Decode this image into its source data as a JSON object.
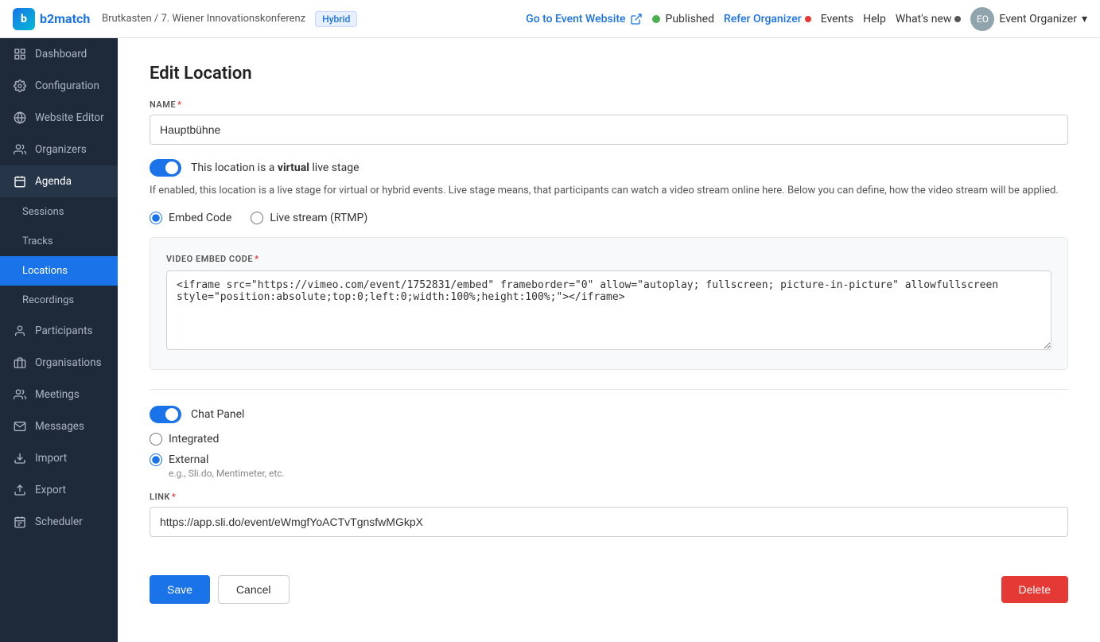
{
  "topnav": {
    "logo_text": "b2match",
    "breadcrumb_org": "Brutkasten",
    "breadcrumb_event": "7. Wiener Innovationskonferenz",
    "badge_label": "Hybrid",
    "goto_label": "Go to Event Website",
    "published_label": "Published",
    "refer_label": "Refer Organizer",
    "events_label": "Events",
    "help_label": "Help",
    "whatsnew_label": "What's new",
    "user_label": "Event Organizer"
  },
  "sidebar": {
    "items": [
      {
        "label": "Dashboard",
        "icon": "grid",
        "active": false
      },
      {
        "label": "Configuration",
        "icon": "settings",
        "active": false
      },
      {
        "label": "Website Editor",
        "icon": "web",
        "active": false
      },
      {
        "label": "Organizers",
        "icon": "people",
        "active": false
      },
      {
        "label": "Agenda",
        "icon": "calendar",
        "active": true
      }
    ],
    "agenda_sub": [
      {
        "label": "Sessions",
        "active": false
      },
      {
        "label": "Tracks",
        "active": false
      },
      {
        "label": "Locations",
        "active": true
      },
      {
        "label": "Recordings",
        "active": false
      }
    ],
    "other_items": [
      {
        "label": "Participants",
        "icon": "person"
      },
      {
        "label": "Organisations",
        "icon": "building"
      },
      {
        "label": "Meetings",
        "icon": "handshake"
      },
      {
        "label": "Messages",
        "icon": "envelope"
      },
      {
        "label": "Import",
        "icon": "import"
      },
      {
        "label": "Export",
        "icon": "export"
      },
      {
        "label": "Scheduler",
        "icon": "scheduler"
      }
    ]
  },
  "form": {
    "page_title": "Edit Location",
    "name_label": "NAME",
    "name_value": "Hauptbühne",
    "toggle_description": "This location is a",
    "toggle_bold": "virtual",
    "toggle_after": "live stage",
    "info_text": "If enabled, this location is a live stage for virtual or hybrid events. Live stage means, that participants can watch a video stream online here. Below you can define, how the video stream will be applied.",
    "embed_code_label": "Embed Code",
    "livestream_label": "Live stream (RTMP)",
    "section_label": "VIDEO EMBED CODE",
    "code_value": "<iframe src=\"https://vimeo.com/event/1752831/embed\" frameborder=\"0\" allow=\"autoplay; fullscreen; picture-in-picture\" allowfullscreen style=\"position:absolute;top:0;left:0;width:100%;height:100%;\"></iframe>",
    "chat_panel_label": "Chat Panel",
    "integrated_label": "Integrated",
    "external_label": "External",
    "external_hint": "e.g., Sli.do, Mentimeter, etc.",
    "link_label": "LINK",
    "link_value": "https://app.sli.do/event/eWmgfYoACTvTgnsfwMGkpX",
    "save_label": "Save",
    "cancel_label": "Cancel",
    "delete_label": "Delete"
  }
}
